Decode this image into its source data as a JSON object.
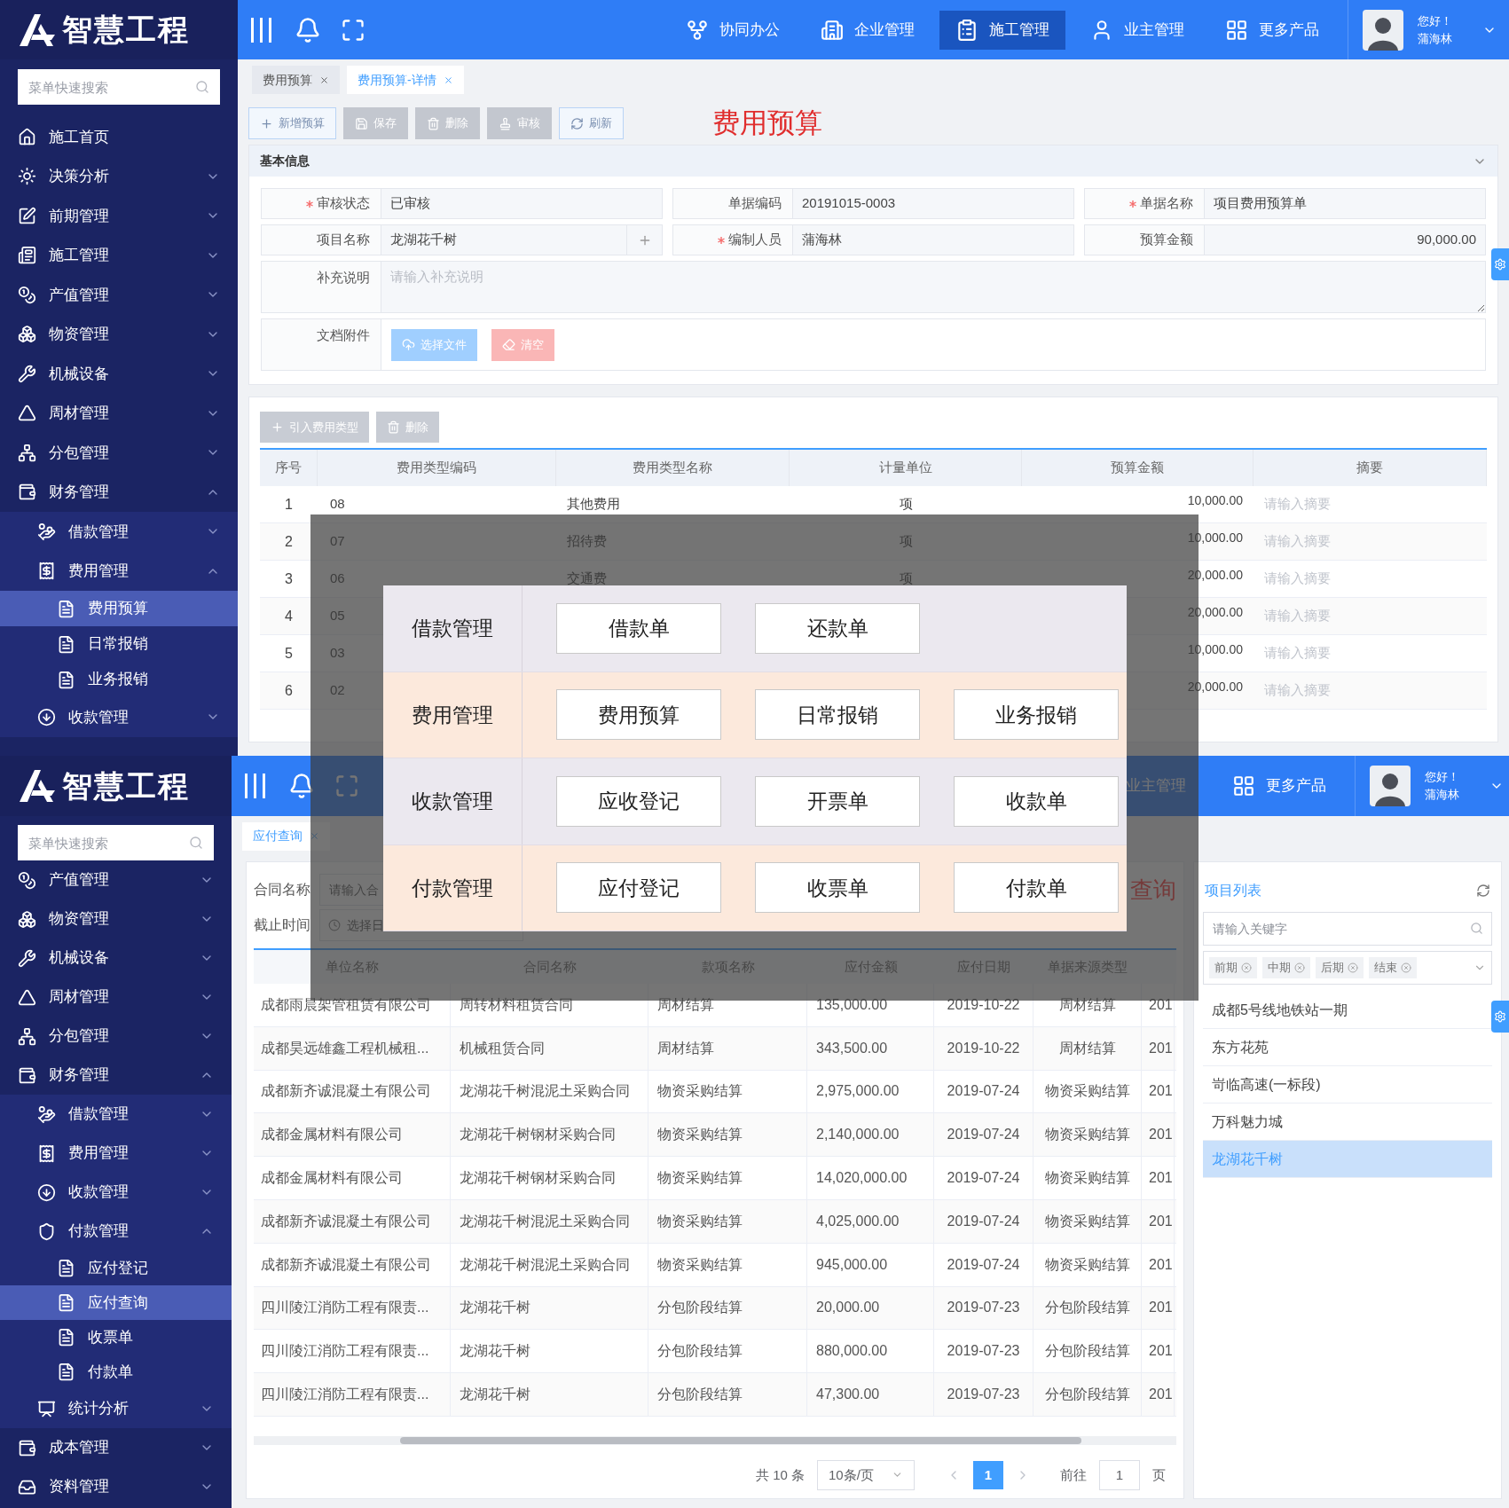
{
  "top_screen": {
    "logo": "智慧工程",
    "search": {
      "placeholder": "菜单快速搜索"
    },
    "sidebar": [
      {
        "label": "施工首页",
        "selected": false
      },
      {
        "label": "决策分析",
        "expanded": false,
        "selected": false
      },
      {
        "label": "前期管理",
        "expanded": false,
        "selected": false
      },
      {
        "label": "施工管理",
        "expanded": false,
        "selected": false
      },
      {
        "label": "产值管理",
        "expanded": false,
        "selected": false
      },
      {
        "label": "物资管理",
        "expanded": false,
        "selected": false
      },
      {
        "label": "机械设备",
        "expanded": false,
        "selected": false
      },
      {
        "label": "周材管理",
        "expanded": false,
        "selected": false
      },
      {
        "label": "分包管理",
        "expanded": false,
        "selected": false
      },
      {
        "label": "财务管理",
        "expanded": true,
        "selected": false,
        "children": [
          {
            "label": "借款管理",
            "expanded": false,
            "selected": false
          },
          {
            "label": "费用管理",
            "expanded": true,
            "selected": false,
            "children": [
              {
                "label": "费用预算",
                "selected": true
              },
              {
                "label": "日常报销",
                "selected": false
              },
              {
                "label": "业务报销",
                "selected": false
              }
            ]
          },
          {
            "label": "收款管理",
            "expanded": false,
            "selected": false
          }
        ]
      }
    ],
    "nav": [
      {
        "label": "协同办公",
        "selected": false
      },
      {
        "label": "企业管理",
        "selected": false
      },
      {
        "label": "施工管理",
        "selected": true
      },
      {
        "label": "业主管理",
        "selected": false
      },
      {
        "label": "更多产品",
        "selected": false
      }
    ],
    "user": {
      "greeting": "您好！",
      "name": "蒲海林"
    },
    "tabs": [
      {
        "label": "费用预算",
        "selected": false
      },
      {
        "label": "费用预算-详情",
        "selected": true
      }
    ],
    "toolbar": [
      {
        "label": "新增预算",
        "disabled": false
      },
      {
        "label": "保存",
        "disabled": true
      },
      {
        "label": "删除",
        "disabled": true
      },
      {
        "label": "审核",
        "disabled": true
      },
      {
        "label": "刷新",
        "disabled": false
      }
    ],
    "page_title": "费用预算",
    "section": {
      "title": "基本信息"
    },
    "fields": [
      {
        "label": "审核状态",
        "required": true,
        "value": "已审核",
        "kind": "text"
      },
      {
        "label": "单据编码",
        "required": false,
        "value": "20191015-0003",
        "kind": "text"
      },
      {
        "label": "单据名称",
        "required": true,
        "value": "项目费用预算单",
        "kind": "text"
      },
      {
        "label": "项目名称",
        "required": false,
        "value": "龙湖花千树",
        "kind": "picker"
      },
      {
        "label": "编制人员",
        "required": true,
        "value": "蒲海林",
        "kind": "text"
      },
      {
        "label": "预算金额",
        "required": false,
        "value": "90,000.00",
        "kind": "number"
      }
    ],
    "remark": {
      "label": "补充说明",
      "placeholder": "请输入补充说明"
    },
    "attachments": {
      "label": "文档附件",
      "buttons": [
        {
          "label": "选择文件",
          "kind": "upload"
        },
        {
          "label": "清空",
          "kind": "clear"
        }
      ]
    },
    "detail_toolbar": [
      {
        "label": "引入费用类型",
        "disabled": true
      },
      {
        "label": "删除",
        "disabled": true
      }
    ],
    "detail_table": {
      "columns": [
        "序号",
        "费用类型编码",
        "费用类型名称",
        "计量单位",
        "预算金额",
        "摘要"
      ],
      "rows": [
        {
          "index": "1",
          "code": "08",
          "name": "其他费用",
          "unit": "项",
          "amount": "10,000.00",
          "note_placeholder": "请输入摘要"
        },
        {
          "index": "2",
          "code": "07",
          "name": "招待费",
          "unit": "项",
          "amount": "10,000.00",
          "note_placeholder": "请输入摘要"
        },
        {
          "index": "3",
          "code": "06",
          "name": "交通费",
          "unit": "项",
          "amount": "20,000.00",
          "note_placeholder": "请输入摘要"
        },
        {
          "index": "4",
          "code": "05",
          "amount": "20,000.00",
          "note_placeholder": "请输入摘要"
        },
        {
          "index": "5",
          "code": "03",
          "amount": "10,000.00",
          "note_placeholder": "请输入摘要"
        },
        {
          "index": "6",
          "code": "02",
          "amount": "20,000.00",
          "note_placeholder": "请输入摘要"
        }
      ]
    }
  },
  "bottom_screen": {
    "logo": "智慧工程",
    "search": {
      "placeholder": "菜单快速搜索"
    },
    "sidebar": [
      {
        "label": "产值管理",
        "expanded": false,
        "selected": false
      },
      {
        "label": "物资管理",
        "expanded": false,
        "selected": false
      },
      {
        "label": "机械设备",
        "expanded": false,
        "selected": false
      },
      {
        "label": "周材管理",
        "expanded": false,
        "selected": false
      },
      {
        "label": "分包管理",
        "expanded": false,
        "selected": false
      },
      {
        "label": "财务管理",
        "expanded": true,
        "selected": false,
        "children": [
          {
            "label": "借款管理",
            "expanded": false,
            "selected": false
          },
          {
            "label": "费用管理",
            "expanded": false,
            "selected": false
          },
          {
            "label": "收款管理",
            "expanded": false,
            "selected": false
          },
          {
            "label": "付款管理",
            "expanded": true,
            "selected": false,
            "children": [
              {
                "label": "应付登记",
                "selected": false
              },
              {
                "label": "应付查询",
                "selected": true
              },
              {
                "label": "收票单",
                "selected": false
              },
              {
                "label": "付款单",
                "selected": false
              }
            ]
          },
          {
            "label": "统计分析",
            "expanded": false,
            "selected": false
          }
        ]
      },
      {
        "label": "成本管理",
        "expanded": false,
        "selected": false
      },
      {
        "label": "资料管理",
        "expanded": false,
        "selected": false
      }
    ],
    "nav": [
      {
        "label": "业主管理",
        "selected": false
      },
      {
        "label": "更多产品",
        "selected": false
      }
    ],
    "user": {
      "greeting": "您好！",
      "name": "蒲海林"
    },
    "tabs": [
      {
        "label": "应付查询",
        "selected": true
      }
    ],
    "filters": [
      {
        "label": "合同名称",
        "placeholder": "请输入合"
      },
      {
        "label": "截止时间",
        "placeholder": "选择日"
      }
    ],
    "title_fragment": "查询",
    "table": {
      "columns": [
        "单位名称",
        "合同名称",
        "款项名称",
        "应付金额",
        "应付日期",
        "单据来源类型"
      ],
      "rows": [
        [
          "成都雨晨架管租赁有限公司",
          "周转材料租赁合同",
          "周材结算",
          "135,000.00",
          "2019-10-22",
          "周材结算",
          "201"
        ],
        [
          "成都昊远雄鑫工程机械租...",
          "机械租赁合同",
          "周材结算",
          "343,500.00",
          "2019-10-22",
          "周材结算",
          "201"
        ],
        [
          "成都新齐诚混凝土有限公司",
          "龙湖花千树混泥土采购合同",
          "物资采购结算",
          "2,975,000.00",
          "2019-07-24",
          "物资采购结算",
          "201"
        ],
        [
          "成都金属材料有限公司",
          "龙湖花千树钢材采购合同",
          "物资采购结算",
          "2,140,000.00",
          "2019-07-24",
          "物资采购结算",
          "201"
        ],
        [
          "成都金属材料有限公司",
          "龙湖花千树钢材采购合同",
          "物资采购结算",
          "14,020,000.00",
          "2019-07-24",
          "物资采购结算",
          "201"
        ],
        [
          "成都新齐诚混凝土有限公司",
          "龙湖花千树混泥土采购合同",
          "物资采购结算",
          "4,025,000.00",
          "2019-07-24",
          "物资采购结算",
          "201"
        ],
        [
          "成都新齐诚混凝土有限公司",
          "龙湖花千树混泥土采购合同",
          "物资采购结算",
          "945,000.00",
          "2019-07-24",
          "物资采购结算",
          "201"
        ],
        [
          "四川陵江消防工程有限责...",
          "龙湖花千树",
          "分包阶段结算",
          "20,000.00",
          "2019-07-23",
          "分包阶段结算",
          "201"
        ],
        [
          "四川陵江消防工程有限责...",
          "龙湖花千树",
          "分包阶段结算",
          "880,000.00",
          "2019-07-23",
          "分包阶段结算",
          "201"
        ],
        [
          "四川陵江消防工程有限责...",
          "龙湖花千树",
          "分包阶段结算",
          "47,300.00",
          "2019-07-23",
          "分包阶段结算",
          "201"
        ]
      ]
    },
    "pagination": {
      "total": "共 10 条",
      "page_size": "10条/页",
      "pages": [
        {
          "label": "1",
          "selected": true
        }
      ],
      "goto_label": "前往",
      "goto_value": "1",
      "page_label": "页"
    },
    "projects": {
      "title": "项目列表",
      "search_placeholder": "请输入关键字",
      "tags": [
        "前期",
        "中期",
        "后期",
        "结束"
      ],
      "items": [
        {
          "label": "成都5号线地铁站一期",
          "selected": false
        },
        {
          "label": "东方花苑",
          "selected": false
        },
        {
          "label": "岢临高速(一标段)",
          "selected": false
        },
        {
          "label": "万科魅力城",
          "selected": false
        },
        {
          "label": "龙湖花千树",
          "selected": true
        }
      ]
    }
  },
  "overlay_menu": {
    "groups": [
      {
        "label": "借款管理",
        "items": [
          "借款单",
          "还款单"
        ]
      },
      {
        "label": "费用管理",
        "items": [
          "费用预算",
          "日常报销",
          "业务报销"
        ]
      },
      {
        "label": "收款管理",
        "items": [
          "应收登记",
          "开票单",
          "收款单"
        ]
      },
      {
        "label": "付款管理",
        "items": [
          "应付登记",
          "收票单",
          "付款单"
        ]
      }
    ]
  }
}
